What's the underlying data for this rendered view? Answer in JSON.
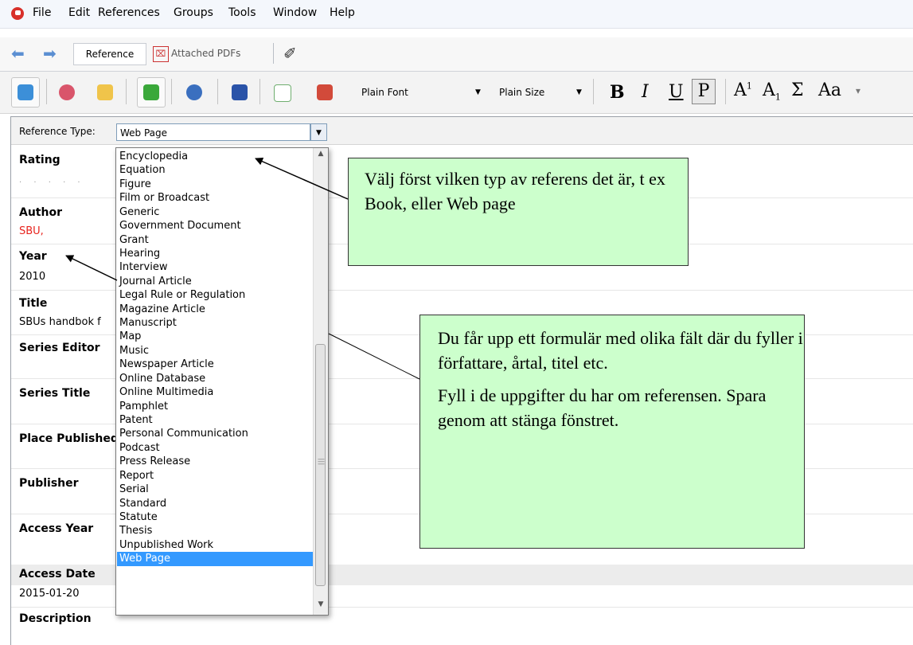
{
  "menu": {
    "items": [
      "File",
      "Edit",
      "References",
      "Groups",
      "Tools",
      "Window",
      "Help"
    ]
  },
  "tabs": {
    "reference": "Reference",
    "attached_pdfs": "Attached PDFs"
  },
  "toolbar": {
    "font": "Plain Font",
    "size": "Plain Size",
    "bold": "B",
    "italic": "I",
    "underline": "U",
    "plain": "P",
    "superscript": "A",
    "superscript_mark": "1",
    "subscript": "A",
    "subscript_mark": "1",
    "symbol": "Σ",
    "case": "Aa"
  },
  "form": {
    "reference_type_label": "Reference Type:",
    "reference_type_value": "Web Page",
    "fields": {
      "rating": {
        "label": "Rating",
        "value": "· · · · ·"
      },
      "author": {
        "label": "Author",
        "value": "SBU,"
      },
      "year": {
        "label": "Year",
        "value": "2010"
      },
      "title": {
        "label": "Title",
        "value": "SBUs handbok f"
      },
      "series_editor": {
        "label": "Series Editor"
      },
      "series_title": {
        "label": "Series Title"
      },
      "place_published": {
        "label": "Place Published"
      },
      "publisher": {
        "label": "Publisher"
      },
      "access_year": {
        "label": "Access Year"
      },
      "access_date": {
        "label": "Access Date",
        "value": "2015-01-20"
      },
      "description": {
        "label": "Description"
      }
    }
  },
  "dropdown_options": [
    "Encyclopedia",
    "Equation",
    "Figure",
    "Film or Broadcast",
    "Generic",
    "Government Document",
    "Grant",
    "Hearing",
    "Interview",
    "Journal Article",
    "Legal Rule or Regulation",
    "Magazine Article",
    "Manuscript",
    "Map",
    "Music",
    "Newspaper Article",
    "Online Database",
    "Online Multimedia",
    "Pamphlet",
    "Patent",
    "Personal Communication",
    "Podcast",
    "Press Release",
    "Report",
    "Serial",
    "Standard",
    "Statute",
    "Thesis",
    "Unpublished Work",
    "Web Page"
  ],
  "selected_option": "Web Page",
  "callouts": {
    "first": "Välj först vilken typ av referens det är, t ex Book, eller Web page",
    "second_p1": "Du får upp ett formulär med olika fält där du fyller i författare, årtal, titel etc.",
    "second_p2": "Fyll i de uppgifter du har om referensen. Spara genom att stänga fönstret."
  },
  "colors": {
    "callout_bg": "#ccffcc",
    "selection": "#3399ff",
    "author_value": "#e8231d"
  }
}
